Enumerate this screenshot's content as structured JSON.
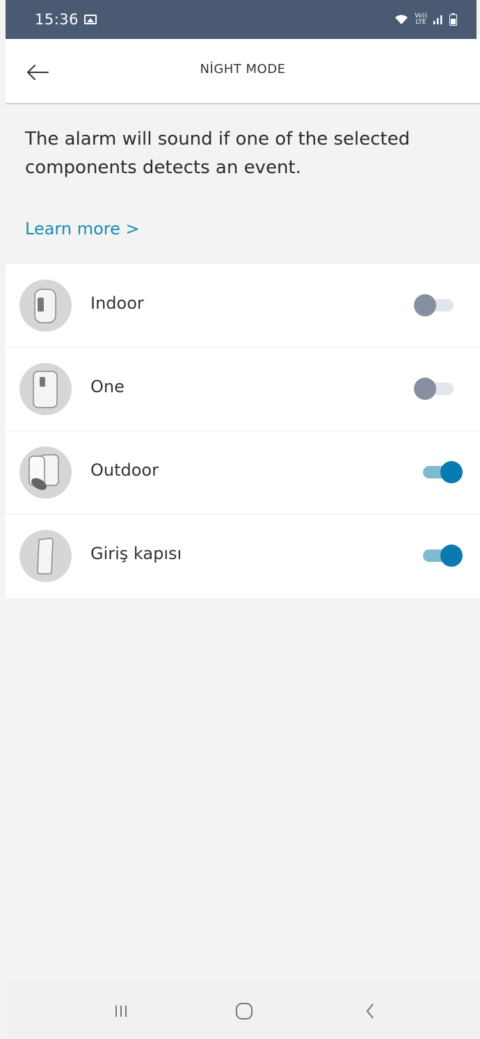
{
  "status_bar": {
    "time": "15:36",
    "icons": [
      "image-notification-icon",
      "wifi-icon",
      "volte-icon",
      "signal-icon",
      "battery-icon"
    ],
    "volte_top": "Vo))",
    "volte_bottom": "LTE"
  },
  "header": {
    "title": "NİGHT MODE",
    "back_icon": "arrow-left-icon"
  },
  "intro": {
    "description": "The alarm will sound if one of the selected components detects an event.",
    "learn_more": "Learn more >"
  },
  "components": [
    {
      "name": "Indoor",
      "enabled": false,
      "icon": "indoor-camera-icon"
    },
    {
      "name": "One",
      "enabled": false,
      "icon": "one-camera-icon"
    },
    {
      "name": "Outdoor",
      "enabled": true,
      "icon": "outdoor-camera-icon"
    },
    {
      "name": "Giriş kapısı",
      "enabled": true,
      "icon": "door-sensor-icon"
    }
  ],
  "colors": {
    "status_bar_bg": "#4a5a72",
    "accent": "#0a7bb0",
    "link": "#1a8bb5",
    "toggle_off_knob": "#8690a0"
  },
  "nav_bar": {
    "icons": [
      "recent-apps-icon",
      "home-icon",
      "back-icon"
    ]
  }
}
